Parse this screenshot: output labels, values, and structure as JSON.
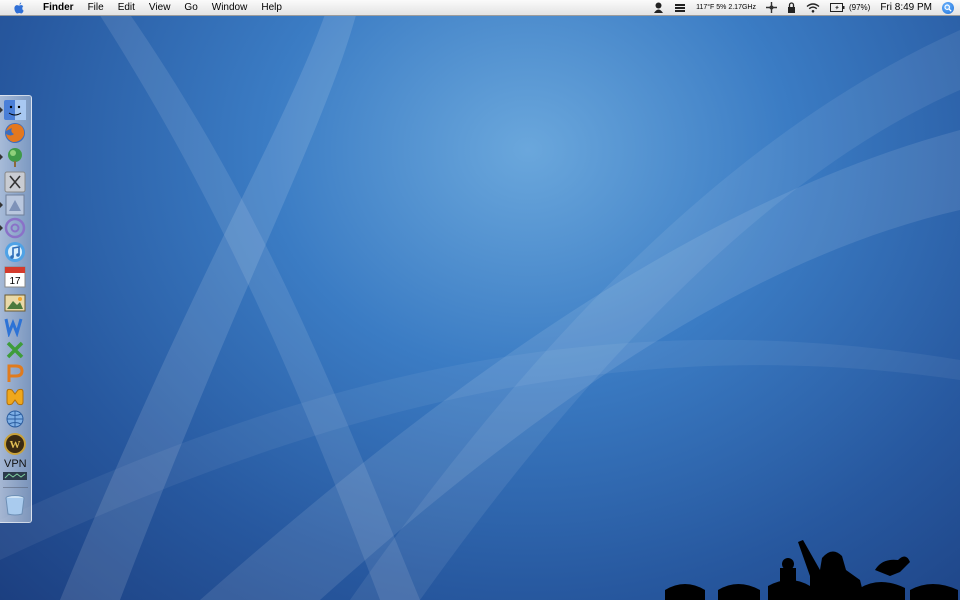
{
  "menubar": {
    "app_name": "Finder",
    "menus": [
      "File",
      "Edit",
      "View",
      "Go",
      "Window",
      "Help"
    ],
    "status_temp_cpu": "117°F 5% 2.17GHz",
    "battery_percent": "(97%)",
    "clock": "Fri 8:49 PM"
  },
  "dock": {
    "vpn_label": "VPN",
    "items": [
      "finder-icon",
      "firefox-icon",
      "camino-icon",
      "x11-icon",
      "preview-icon",
      "mail-icon",
      "itunes-icon",
      "ical-icon",
      "iphoto-icon",
      "word-icon",
      "excel-icon",
      "powerpoint-icon",
      "messenger-icon",
      "globe-icon",
      "world-of-warcraft-icon",
      "vpn-icon",
      "trash-icon"
    ]
  },
  "colors": {
    "menubar": "#eeeeee",
    "desktop_light": "#6aa7dc",
    "desktop_dark": "#1c3f80"
  }
}
